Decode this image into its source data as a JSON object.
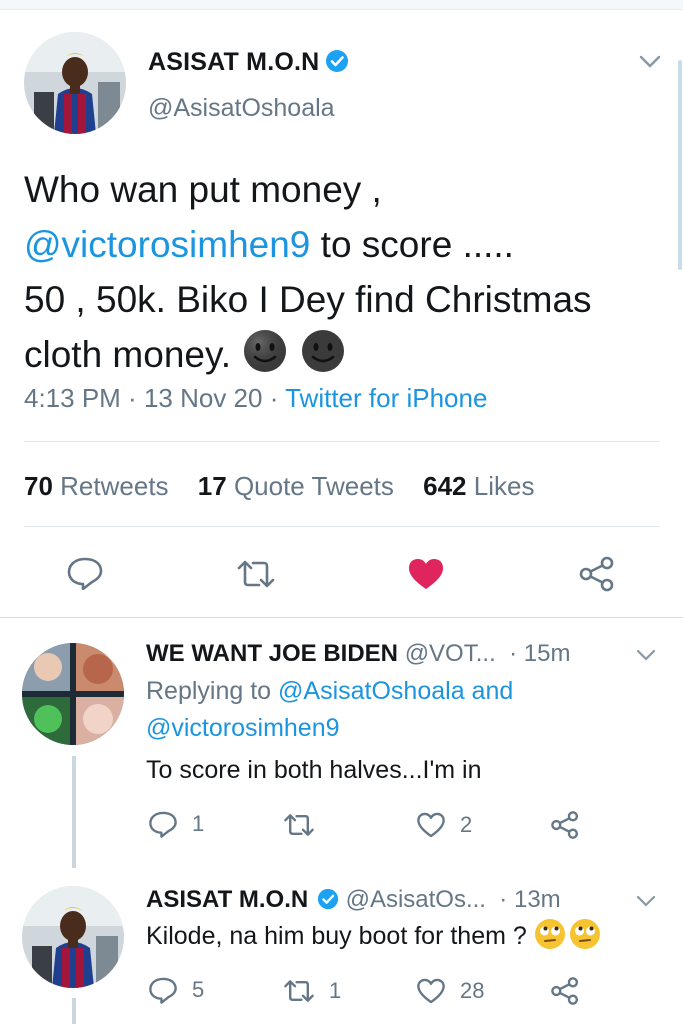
{
  "main_tweet": {
    "author_name": "ASISAT M.O.N",
    "author_handle": "@AsisatOshoala",
    "verified": true,
    "text_parts": {
      "line1": "Who wan put money ,",
      "mention": "@victorosimhen9",
      "line2_rest": " to score .....",
      "line3": "50 , 50k. Biko I Dey find Christmas",
      "line4": "cloth money."
    },
    "emoji": "slightly-smiling-face-dark x2",
    "time": "4:13 PM",
    "date": "13 Nov 20",
    "source": "Twitter for iPhone",
    "stats": {
      "retweets_count": "70",
      "retweets_label": "Retweets",
      "quotes_count": "17",
      "quotes_label": "Quote Tweets",
      "likes_count": "642",
      "likes_label": "Likes"
    },
    "actions": {
      "reply_icon": "reply-icon",
      "retweet_icon": "retweet-icon",
      "like_icon": "heart-icon-filled",
      "like_color": "#e0245e",
      "share_icon": "share-icon"
    }
  },
  "replies": [
    {
      "author_name": "WE WANT JOE BIDEN",
      "author_handle": "@VOT...",
      "time": "15m",
      "replying_prefix": "Replying to ",
      "replying_to_1": "@AsisatOshoala",
      "replying_and": " and",
      "replying_to_2": "@victorosimhen9",
      "text": "To score in both halves...I'm in",
      "reply_count": "1",
      "retweet_count": "",
      "like_count": "2"
    },
    {
      "author_name": "ASISAT M.O.N",
      "author_handle": "@AsisatOs...",
      "verified": true,
      "time": "13m",
      "text": "Kilode, na him buy boot for them ?",
      "emoji": "face-with-rolling-eyes x2",
      "reply_count": "5",
      "retweet_count": "1",
      "like_count": "28"
    }
  ],
  "colors": {
    "accent": "#1b95e0",
    "verified": "#1da1f2",
    "muted": "#657786",
    "like": "#e0245e"
  }
}
